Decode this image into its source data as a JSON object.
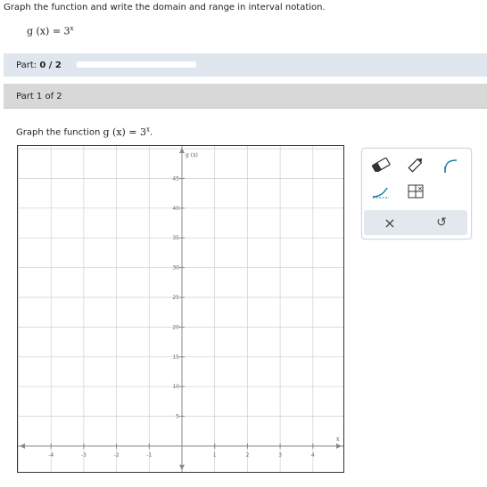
{
  "question": {
    "title": "Graph the function and write the domain and range in interval notation.",
    "formula_lhs": "g (x) = 3",
    "formula_exp": "x"
  },
  "part_bar": {
    "label": "Part:",
    "value": "0 / 2",
    "progress": 0
  },
  "part_of": {
    "label": "Part 1 of 2"
  },
  "instruction": {
    "text": "Graph the function ",
    "formula": "g (x) = 3",
    "exp": "x",
    "end": "."
  },
  "graph": {
    "y_axis_label": "g (x)",
    "x_axis_label": "x",
    "x_ticks": [
      "-4",
      "-3",
      "-2",
      "-1",
      "1",
      "2",
      "3",
      "4"
    ],
    "y_ticks": [
      "5",
      "10",
      "15",
      "20",
      "25",
      "30",
      "35",
      "40",
      "45"
    ]
  },
  "toolbar": {
    "tools": [
      "eraser-icon",
      "pencil-icon",
      "curve-icon",
      "exponential-curve-icon",
      "no-solution-icon"
    ],
    "undo_all": "×",
    "undo": "↺",
    "accent": "#1a7fa6"
  }
}
